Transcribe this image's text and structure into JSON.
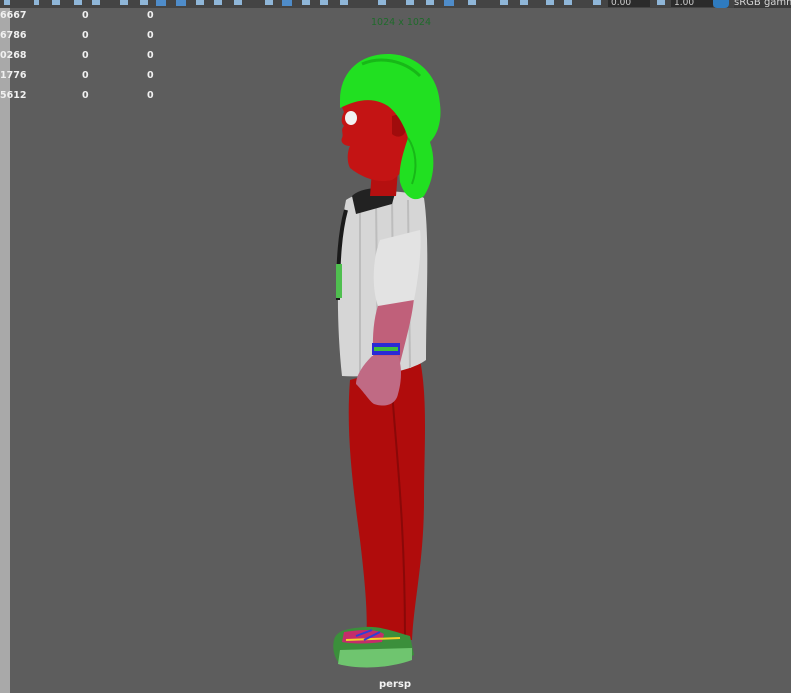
{
  "toolbar": {
    "exposure_value": "0.00",
    "gamma_value": "1.00",
    "color_space": "sRGB gamma"
  },
  "hud": {
    "rows": [
      {
        "a": "6667",
        "b": "0",
        "c": "0"
      },
      {
        "a": "6786",
        "b": "0",
        "c": "0"
      },
      {
        "a": "0268",
        "b": "0",
        "c": "0"
      },
      {
        "a": "1776",
        "b": "0",
        "c": "0"
      },
      {
        "a": "5612",
        "b": "0",
        "c": "0"
      }
    ]
  },
  "viewport": {
    "resolution_gate": "1024 x 1024",
    "camera_name": "persp"
  }
}
